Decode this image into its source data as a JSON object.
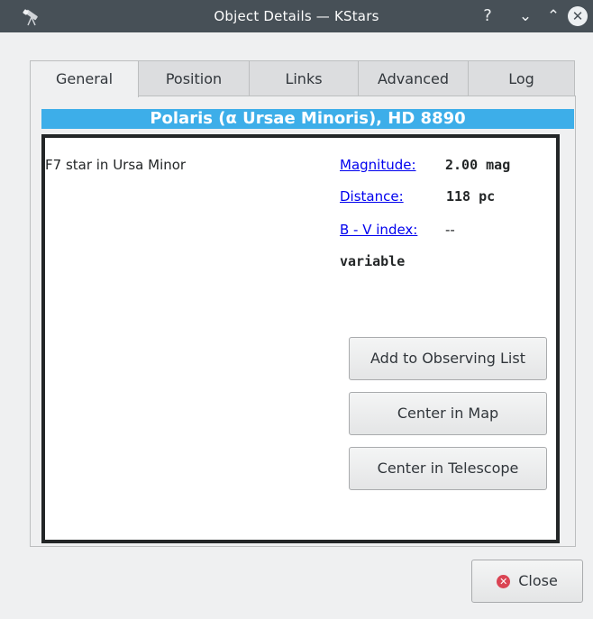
{
  "window": {
    "title": "Object Details — KStars",
    "help_glyph": "?",
    "minimize_glyph": "⌄",
    "maximize_glyph": "⌃",
    "close_glyph": "✕",
    "app_icon": "telescope-icon"
  },
  "tabs": [
    {
      "label": "General",
      "active": true
    },
    {
      "label": "Position",
      "active": false
    },
    {
      "label": "Links",
      "active": false
    },
    {
      "label": "Advanced",
      "active": false
    },
    {
      "label": "Log",
      "active": false
    }
  ],
  "object": {
    "name": "Polaris (α Ursae Minoris), HD 8890",
    "type": "F7 star in Ursa Minor",
    "magnitude_label": "Magnitude:",
    "magnitude_value": "2.00 mag",
    "distance_label": "Distance:",
    "distance_value": "118 pc",
    "bv_label": "B - V index:",
    "bv_value": "--",
    "variability": "variable"
  },
  "actions": {
    "add_observing": "Add to Observing List",
    "center_map": "Center in Map",
    "center_telescope": "Center in Telescope"
  },
  "footer": {
    "close_label": "Close",
    "close_icon": "close-circle-icon"
  },
  "colors": {
    "titlebar": "#475057",
    "banner": "#3daee9",
    "link": "#0000ee",
    "close_icon": "#da4453"
  }
}
